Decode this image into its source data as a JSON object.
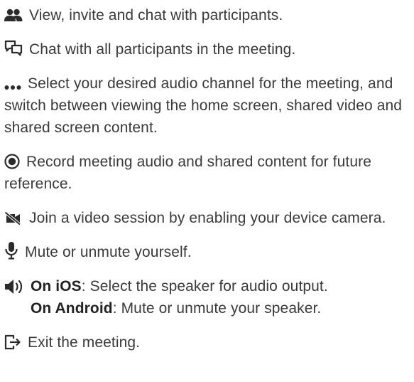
{
  "colors": {
    "text": "#3a3a3a",
    "icon": "#2b2b2b"
  },
  "items": [
    {
      "icon": "participants-icon",
      "text": "View, invite and chat with participants."
    },
    {
      "icon": "chat-icon",
      "text": "Chat with all participants in the meeting."
    },
    {
      "icon": "more-icon",
      "text": "Select your desired audio channel for the meeting, and switch between viewing the home screen, shared video and shared screen content."
    },
    {
      "icon": "record-icon",
      "text": "Record meeting audio and shared content for future reference."
    },
    {
      "icon": "video-off-icon",
      "text": "Join a video session by enabling your device camera."
    },
    {
      "icon": "microphone-icon",
      "text": "Mute or unmute yourself."
    },
    {
      "icon": "speaker-icon",
      "ios_label": "On iOS",
      "ios_text": ": Select the speaker for audio output.",
      "android_label": "On Android",
      "android_text": ": Mute or unmute your speaker."
    },
    {
      "icon": "exit-icon",
      "text": "Exit the meeting."
    }
  ]
}
